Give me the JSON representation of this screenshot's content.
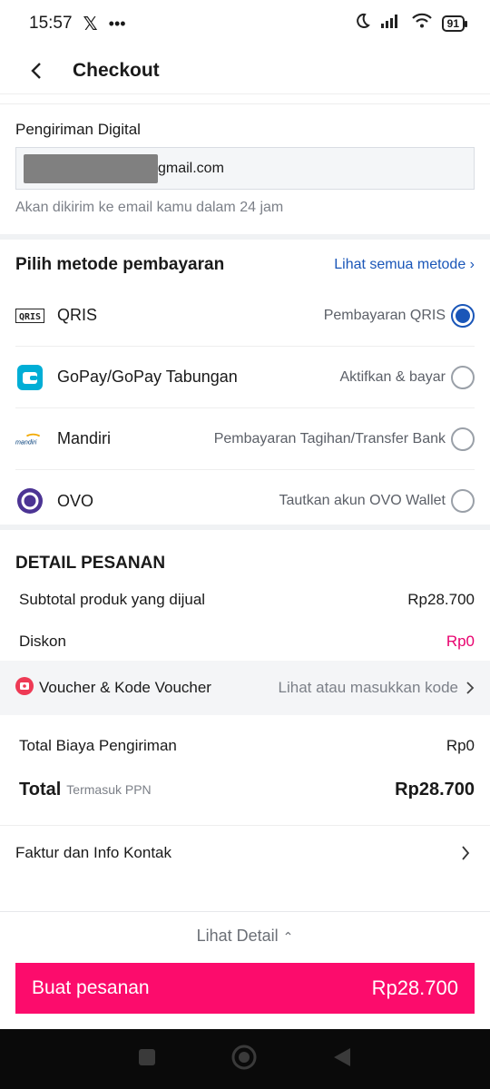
{
  "status": {
    "time": "15:57",
    "battery": "91"
  },
  "header": {
    "title": "Checkout"
  },
  "digital": {
    "label": "Pengiriman Digital",
    "email_visible": "gmail.com",
    "hint": "Akan dikirim ke email kamu dalam 24 jam"
  },
  "payment": {
    "title": "Pilih metode pembayaran",
    "see_all": "Lihat semua metode ›",
    "methods": [
      {
        "name": "QRIS",
        "desc": "Pembayaran QRIS",
        "selected": true,
        "icon": "qris-icon"
      },
      {
        "name": "GoPay/GoPay Tabungan",
        "desc": "Aktifkan & bayar",
        "selected": false,
        "icon": "gopay-icon"
      },
      {
        "name": "Mandiri",
        "desc": "Pembayaran Tagihan/Transfer Bank",
        "selected": false,
        "icon": "mandiri-icon"
      },
      {
        "name": "OVO",
        "desc": "Tautkan akun OVO Wallet",
        "selected": false,
        "icon": "ovo-icon"
      }
    ]
  },
  "detail": {
    "title": "DETAIL PESANAN",
    "subtotal_label": "Subtotal produk yang dijual",
    "subtotal_value": "Rp28.700",
    "discount_label": "Diskon",
    "discount_value": "Rp0",
    "voucher_label": "Voucher & Kode Voucher",
    "voucher_hint": "Lihat atau masukkan kode",
    "shipping_label": "Total Biaya Pengiriman",
    "shipping_value": "Rp0",
    "total_label": "Total",
    "total_sub": "Termasuk PPN",
    "total_value": "Rp28.700"
  },
  "invoice": {
    "label": "Faktur dan Info Kontak"
  },
  "footer": {
    "see_detail": "Lihat Detail",
    "order_label": "Buat pesanan",
    "order_price": "Rp28.700"
  },
  "colors": {
    "accent": "#fc0c6c",
    "link": "#1a56b8"
  }
}
